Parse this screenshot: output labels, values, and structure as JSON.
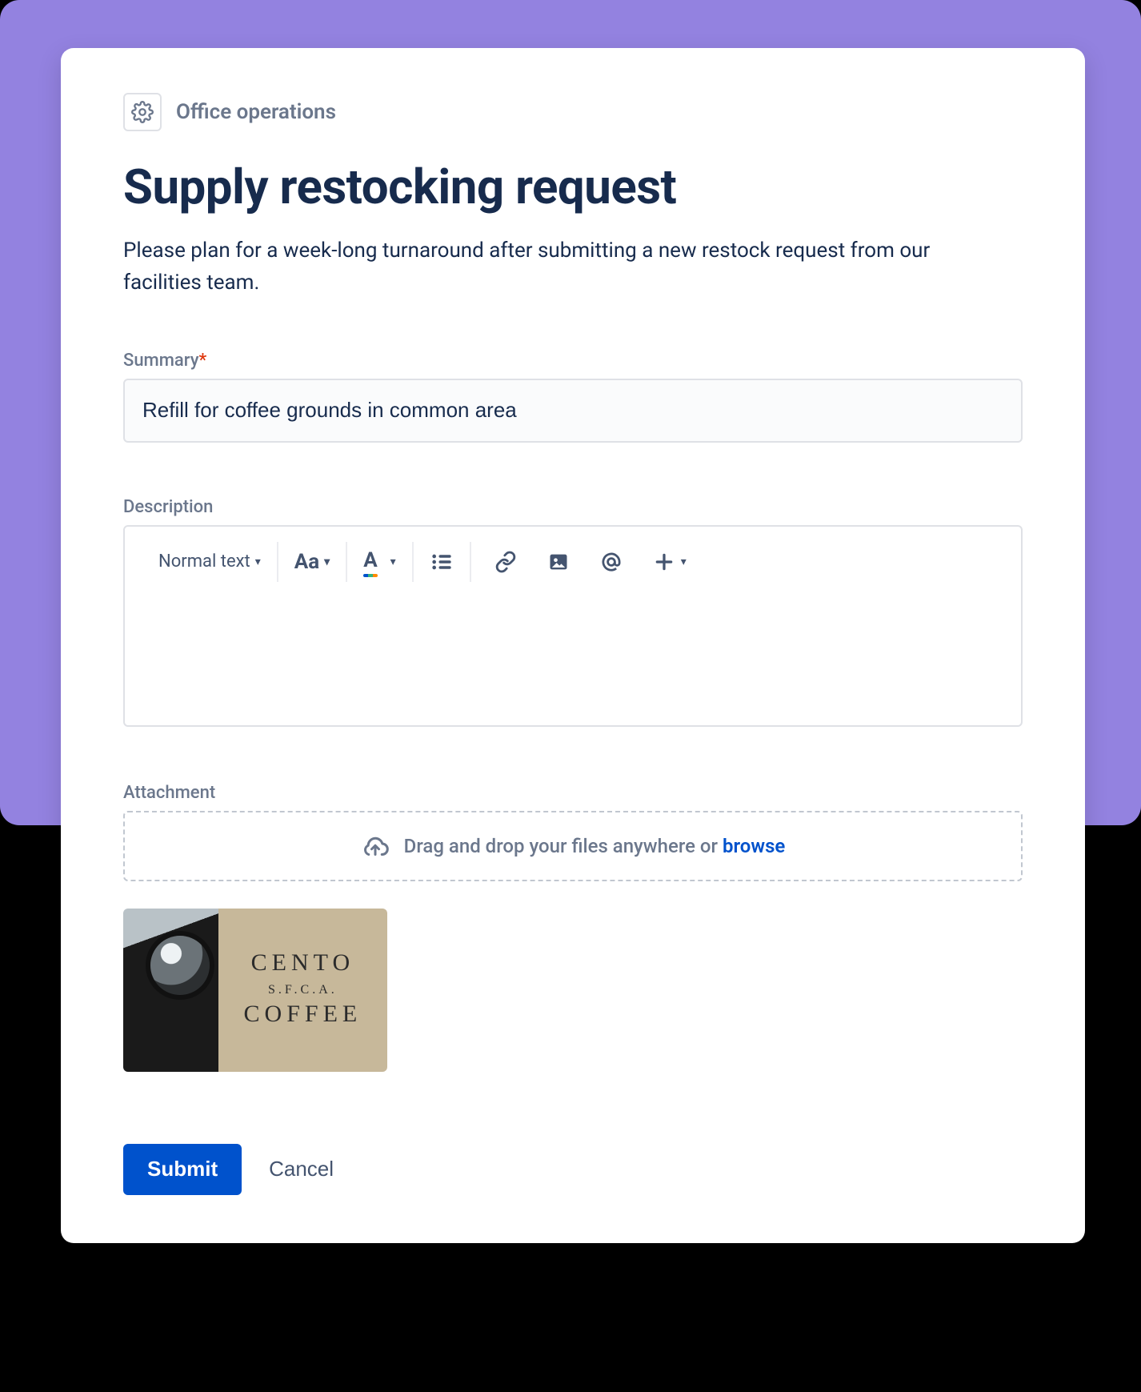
{
  "project": {
    "name": "Office operations"
  },
  "title": "Supply restocking request",
  "description": "Please plan for a week-long turnaround after submitting a new restock request from our facilities team.",
  "fields": {
    "summary": {
      "label": "Summary",
      "required_marker": "*",
      "value": "Refill for coffee grounds in common area"
    },
    "descriptionField": {
      "label": "Description",
      "toolbar": {
        "text_style": "Normal text"
      }
    },
    "attachment": {
      "label": "Attachment",
      "dropzone_text": "Drag and drop your files anywhere or ",
      "browse": "browse",
      "thumbnail": {
        "line1": "CENTO",
        "line2": "S.F.C.A.",
        "line3": "COFFEE"
      }
    }
  },
  "actions": {
    "submit": "Submit",
    "cancel": "Cancel"
  }
}
